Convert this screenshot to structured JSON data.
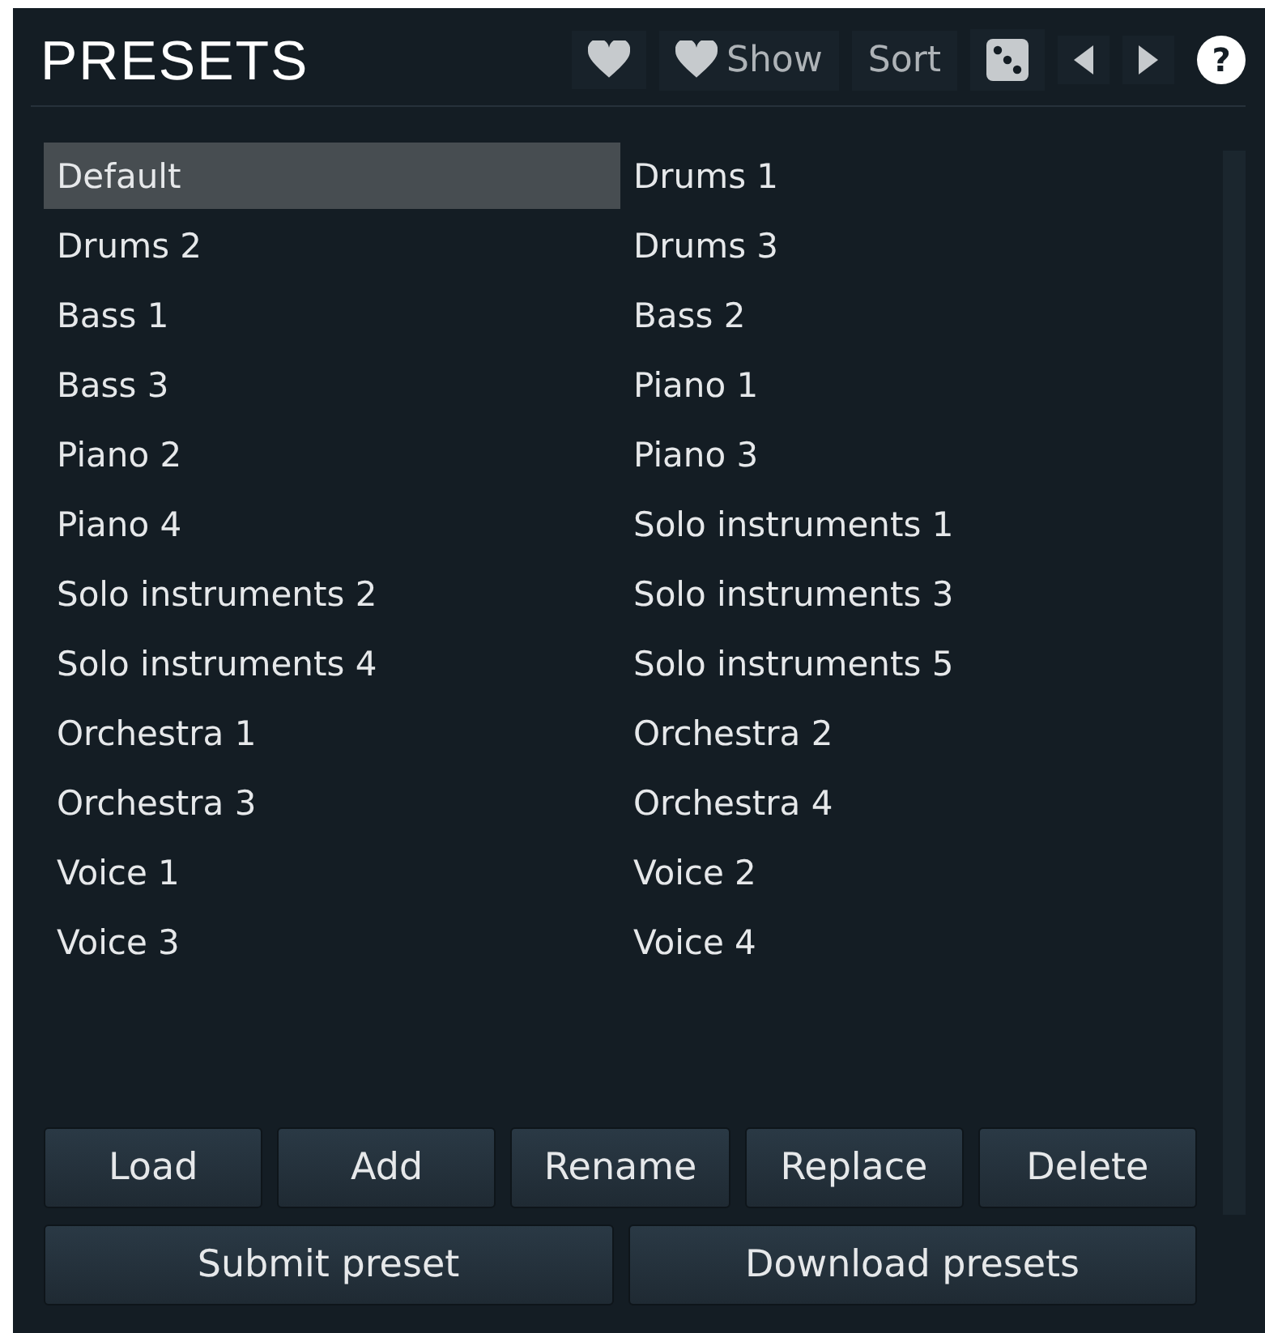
{
  "title": "PRESETS",
  "toolbar": {
    "show_label": "Show",
    "sort_label": "Sort",
    "help_label": "?"
  },
  "presets": [
    {
      "label": "Default",
      "selected": true
    },
    {
      "label": "Drums 1",
      "selected": false
    },
    {
      "label": "Drums 2",
      "selected": false
    },
    {
      "label": "Drums 3",
      "selected": false
    },
    {
      "label": "Bass 1",
      "selected": false
    },
    {
      "label": "Bass 2",
      "selected": false
    },
    {
      "label": "Bass 3",
      "selected": false
    },
    {
      "label": "Piano 1",
      "selected": false
    },
    {
      "label": "Piano 2",
      "selected": false
    },
    {
      "label": "Piano 3",
      "selected": false
    },
    {
      "label": "Piano 4",
      "selected": false
    },
    {
      "label": "Solo instruments 1",
      "selected": false
    },
    {
      "label": "Solo instruments 2",
      "selected": false
    },
    {
      "label": "Solo instruments 3",
      "selected": false
    },
    {
      "label": "Solo instruments 4",
      "selected": false
    },
    {
      "label": "Solo instruments 5",
      "selected": false
    },
    {
      "label": "Orchestra 1",
      "selected": false
    },
    {
      "label": "Orchestra 2",
      "selected": false
    },
    {
      "label": "Orchestra 3",
      "selected": false
    },
    {
      "label": "Orchestra 4",
      "selected": false
    },
    {
      "label": "Voice 1",
      "selected": false
    },
    {
      "label": "Voice 2",
      "selected": false
    },
    {
      "label": "Voice 3",
      "selected": false
    },
    {
      "label": "Voice 4",
      "selected": false
    }
  ],
  "buttons_row_1": [
    "Load",
    "Add",
    "Rename",
    "Replace",
    "Delete"
  ],
  "buttons_row_2": [
    "Submit preset",
    "Download presets"
  ]
}
